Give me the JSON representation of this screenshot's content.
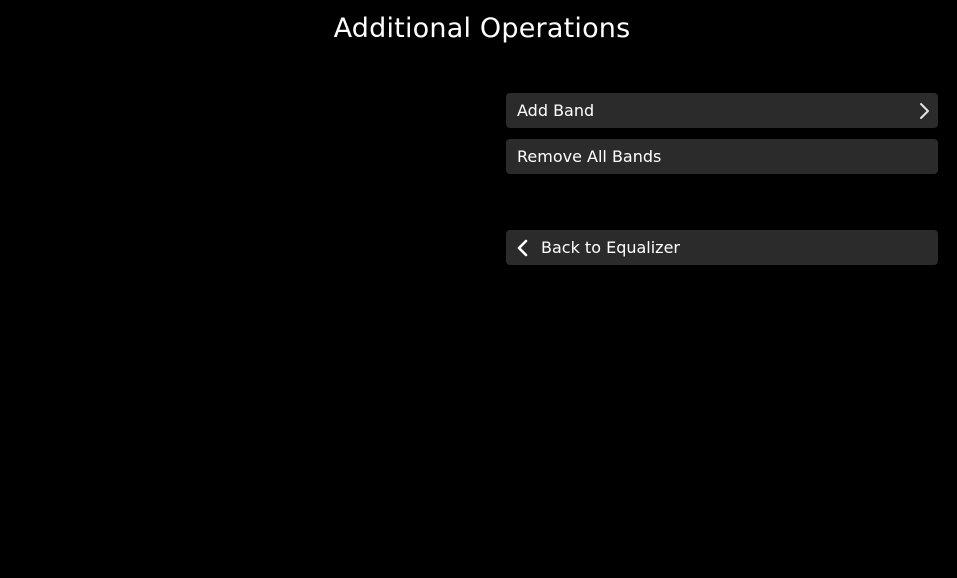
{
  "page": {
    "title": "Additional Operations"
  },
  "menu": {
    "items": [
      {
        "label": "Add Band",
        "icon": "chevron-right-icon"
      },
      {
        "label": "Remove All Bands"
      },
      {
        "label": "Back to Equalizer",
        "icon": "chevron-left-icon"
      }
    ]
  },
  "colors": {
    "background": "#000000",
    "item_background": "#2b2b2b",
    "text": "#ffffff"
  }
}
